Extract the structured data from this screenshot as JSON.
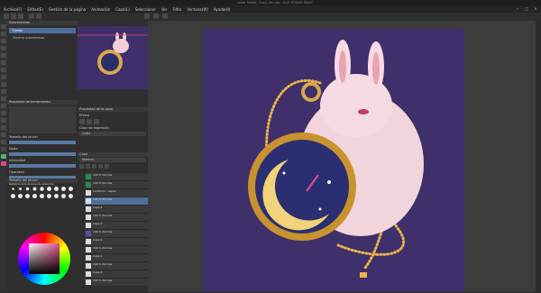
{
  "window": {
    "title": "Lepor Nibbit_ Sunji_Vie.clip - CLIP STUDIO PAINT"
  },
  "menu": [
    "Archivo(F)",
    "Editar(E)",
    "Gestión de la página",
    "Animación",
    "Capa(L)",
    "Seleccionar",
    "Ver",
    "Filtro",
    "Ventana(W)",
    "Ayuda(H)"
  ],
  "subview": {
    "header": "Subventanas",
    "item": "Cerrar",
    "action": "Mostrar subventana"
  },
  "tool_props": {
    "header": "Propiedad de herramienta",
    "sections": [
      "Tamaño del pincel",
      "Modo",
      "Intensidad",
      "Opacidad",
      "Rellenar solo el área de selección"
    ]
  },
  "brush_size": {
    "header": "Tamaño del pincel"
  },
  "layer_props": {
    "header": "Propiedad de la capa",
    "effect": "Efecto",
    "expression": "Color de expresión",
    "color": "Color"
  },
  "layers": {
    "header": "Capa",
    "blend": "Normal",
    "rows": [
      "100 % Normal",
      "100 % Normal",
      "Contorno - capas",
      "100 % Normal",
      "Capa 4",
      "100 % Normal",
      "Capa 3",
      "100 % Normal",
      "Capa 2",
      "100 % Normal",
      "Capa 1",
      "100 % Normal",
      "Capa 5",
      "100 % Normal",
      "Capa 4",
      "100 % Normal",
      "Capa 3",
      "100 % Normal",
      "Capa 2",
      "100 % Normal",
      "Capa 1"
    ]
  },
  "colors": {
    "canvas_bg": "#3f2f6b",
    "accent": "#4f6f9a"
  }
}
